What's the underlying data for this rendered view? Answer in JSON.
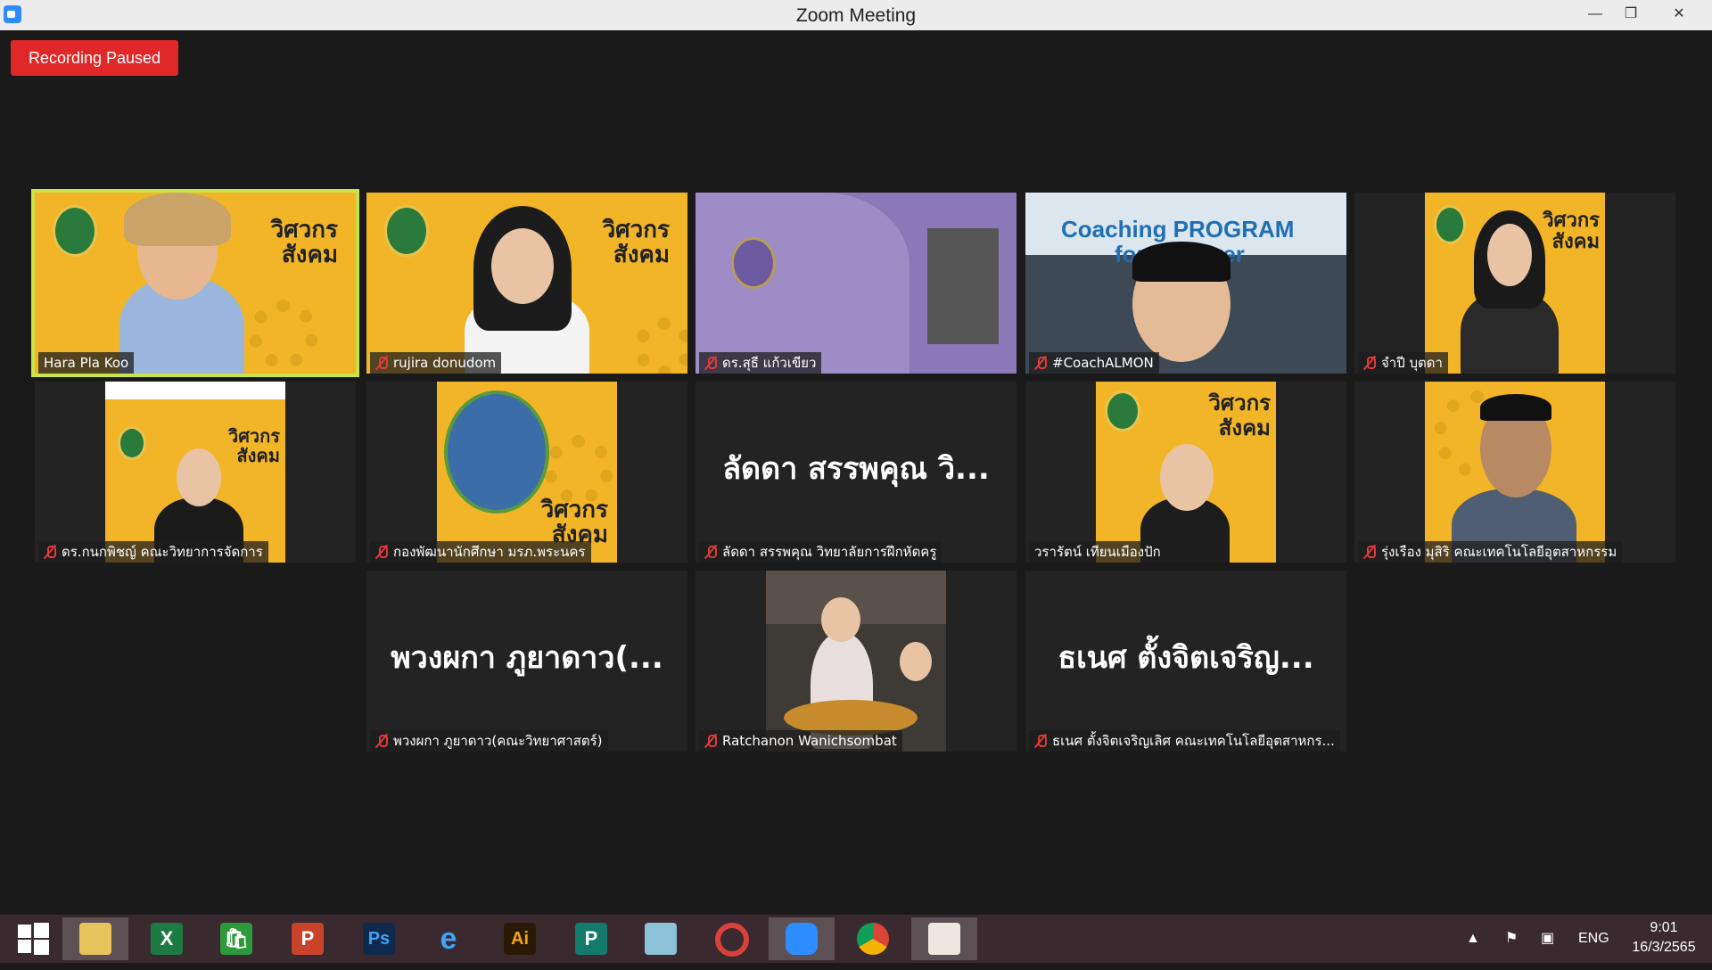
{
  "window": {
    "title": "Zoom Meeting"
  },
  "recording": {
    "status": "Recording Paused"
  },
  "participants": [
    {
      "name": "Hara Pla Koo",
      "muted": false,
      "active_speaker": true,
      "display": "video"
    },
    {
      "name": "rujira donudom",
      "muted": true,
      "display": "video"
    },
    {
      "name": "ดร.สุธี แก้วเขียว",
      "muted": true,
      "display": "video"
    },
    {
      "name": "#CoachALMON",
      "muted": true,
      "display": "video"
    },
    {
      "name": "จำปี บุตดา",
      "muted": true,
      "display": "video"
    },
    {
      "name": "ดร.กนกพิชญ์ คณะวิทยาการจัดการ",
      "muted": true,
      "display": "video"
    },
    {
      "name": "กองพัฒนานักศึกษา มรภ.พระนคร",
      "muted": true,
      "display": "video"
    },
    {
      "name": "ลัดดา สรรพคุณ วิทยาลัยการฝึกหัดครู",
      "muted": true,
      "display": "name",
      "display_name": "ลัดดา สรรพคุณ วิ..."
    },
    {
      "name": "วรารัตน์ เทียนเมืองปัก",
      "muted": false,
      "display": "video"
    },
    {
      "name": "รุ่งเรือง มุสิริ คณะเทคโนโลยีอุตสาหกรรม",
      "muted": true,
      "display": "video"
    },
    {
      "name": "พวงผกา ภูยาดาว(คณะวิทยาศาสตร์)",
      "muted": true,
      "display": "name",
      "display_name": "พวงผกา ภูยาดาว(..."
    },
    {
      "name": "Ratchanon Wanichsombat",
      "muted": true,
      "display": "video"
    },
    {
      "name": "ธเนศ ตั้งจิตเจริญเลิศ คณะเทคโนโลยีอุตสาหกร...",
      "muted": true,
      "display": "name",
      "display_name": "ธเนศ ตั้งจิตเจริญ..."
    }
  ],
  "poster": {
    "line1": "วิศวกร",
    "line2": "สังคม"
  },
  "coaching_banner": {
    "line1": "Coaching PROGRAM",
    "line2": "for Lecturer"
  },
  "taskbar": {
    "apps": [
      "windows-start",
      "file-explorer",
      "excel",
      "store",
      "powerpoint",
      "photoshop",
      "internet-explorer",
      "illustrator",
      "publisher",
      "notepad",
      "photoscape",
      "zoom",
      "chrome",
      "photo-app"
    ],
    "labels": {
      "excel": "X",
      "store": "🛍",
      "powerpoint": "P",
      "photoshop": "Ps",
      "illustrator": "Ai",
      "publisher": "P"
    },
    "language": "ENG",
    "time": "9:01",
    "date": "16/3/2565"
  },
  "colors": {
    "active_speaker": "#c9e34a",
    "recording": "#e02828",
    "poster": "#f2b528",
    "muted_icon": "#e03a3a"
  }
}
